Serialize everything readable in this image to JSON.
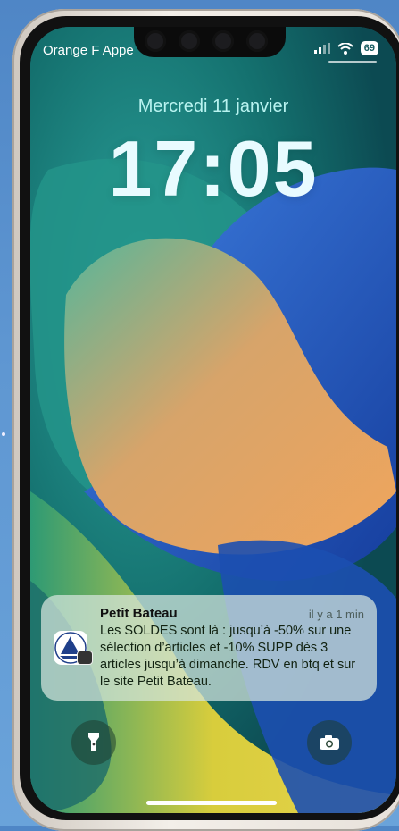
{
  "status_bar": {
    "carrier": "Orange F Appe",
    "battery": "69",
    "icons": [
      "signal-icon",
      "wifi-icon",
      "battery-icon"
    ]
  },
  "lock_screen": {
    "date": "Mercredi 11 janvier",
    "time": "17:05"
  },
  "notification": {
    "app_name": "Petit Bateau",
    "timestamp": "il y a 1 min",
    "message": "Les SOLDES sont là : jusqu’à -50% sur une sélection d’articles et -10% SUPP dès 3 articles jusqu’à dimanche. RDV en btq et sur le site Petit Bateau.",
    "icon": "petit-bateau-logo"
  },
  "quick_actions": {
    "left": "flashlight-icon",
    "right": "camera-icon"
  },
  "colors": {
    "date_text": "#b8f3f0",
    "clock_text": "#e8fbff",
    "wallpaper_teal": "#1b6f74",
    "wallpaper_blue": "#2a5fc4",
    "wallpaper_peach": "#e39a5c",
    "wallpaper_yellow": "#dccf3a"
  }
}
